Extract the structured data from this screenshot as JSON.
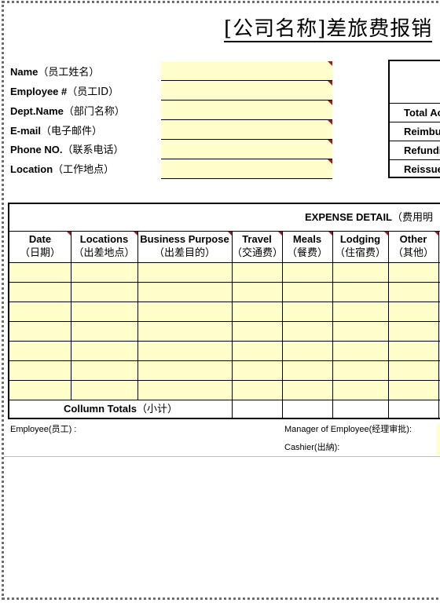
{
  "title": "[公司名称]差旅费报销",
  "employee_info": {
    "fields": [
      {
        "label_en": "Name",
        "label_cn": "（员工姓名）",
        "value": ""
      },
      {
        "label_en": "Employee #",
        "label_cn": "（员工ID）",
        "value": ""
      },
      {
        "label_en": "Dept.Name",
        "label_cn": "（部门名称）",
        "value": ""
      },
      {
        "label_en": "E-mail",
        "label_cn": "（电子邮件）",
        "value": ""
      },
      {
        "label_en": "Phone NO.",
        "label_cn": "（联系电话）",
        "value": ""
      },
      {
        "label_en": "Location",
        "label_cn": "（工作地点）",
        "value": ""
      }
    ]
  },
  "summary_box": {
    "rows": [
      "Total Ac",
      "Reimbu",
      "Refundi",
      "Reissue"
    ]
  },
  "expense_detail": {
    "title_en": "EXPENSE DETAIL",
    "title_cn": "（费用明",
    "columns": [
      {
        "en": "Date",
        "cn": "（日期）"
      },
      {
        "en": "Locations",
        "cn": "（出差地点）"
      },
      {
        "en": "Business Purpose",
        "cn": "（出差目的）"
      },
      {
        "en": "Travel",
        "cn": "（交通费）"
      },
      {
        "en": "Meals",
        "cn": "（餐费）"
      },
      {
        "en": "Lodging",
        "cn": "（住宿费）"
      },
      {
        "en": "Other",
        "cn": "（其他）"
      }
    ],
    "rows": [
      [
        "",
        "",
        "",
        "",
        "",
        "",
        ""
      ],
      [
        "",
        "",
        "",
        "",
        "",
        "",
        ""
      ],
      [
        "",
        "",
        "",
        "",
        "",
        "",
        ""
      ],
      [
        "",
        "",
        "",
        "",
        "",
        "",
        ""
      ],
      [
        "",
        "",
        "",
        "",
        "",
        "",
        ""
      ],
      [
        "",
        "",
        "",
        "",
        "",
        "",
        ""
      ],
      [
        "",
        "",
        "",
        "",
        "",
        "",
        ""
      ]
    ],
    "totals_label_en": "Collumn Totals",
    "totals_label_cn": "（小计）",
    "totals": [
      "",
      "",
      "",
      ""
    ]
  },
  "signatures": {
    "employee": "Employee(员工) :",
    "manager": "Manager of Employee(经理审批):",
    "cashier": "Cashier(出納):"
  },
  "colors": {
    "input_fill": "#ffffcc",
    "comment_marker": "#9b1c1c",
    "border": "#000000"
  }
}
